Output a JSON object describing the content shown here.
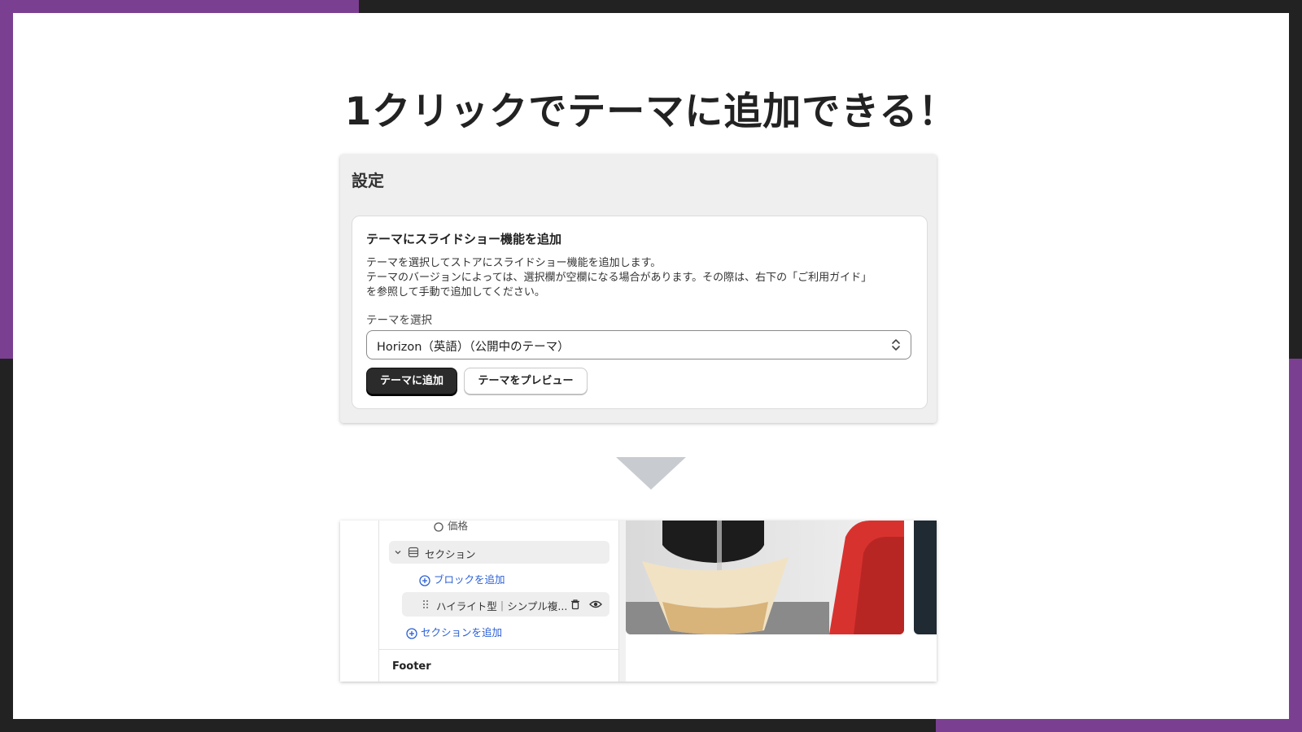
{
  "colors": {
    "accent_purple": "#7b3f91",
    "background_dark": "#222222",
    "primary_button": "#2b2b2b",
    "link_blue": "#2a5fd6"
  },
  "headline": "1クリックでテーマに追加できる！",
  "settings": {
    "title": "設定",
    "card": {
      "title": "テーマにスライドショー機能を追加",
      "description_lines": [
        "テーマを選択してストアにスライドショー機能を追加します。",
        "テーマのバージョンによっては、選択欄が空欄になる場合があります。その際は、右下の「ご利用ガイド」",
        "を参照して手動で追加してください。"
      ],
      "select_label": "テーマを選択",
      "select_value": "Horizon（英語）（公開中のテーマ）",
      "primary_button": "テーマに追加",
      "secondary_button": "テーマをプレビュー"
    }
  },
  "editor": {
    "price_item": "価格",
    "section_item": "セクション",
    "add_block": "ブロックを追加",
    "highlight_item": "ハイライト型｜シンプル複...",
    "add_section": "セクションを追加",
    "footer": "Footer"
  },
  "icons": [
    "price-tag-icon",
    "chevron-down-icon",
    "section-layout-icon",
    "plus-circle-icon",
    "drag-handle-icon",
    "trash-icon",
    "eye-icon",
    "select-chevron-icon",
    "down-arrow-icon"
  ]
}
